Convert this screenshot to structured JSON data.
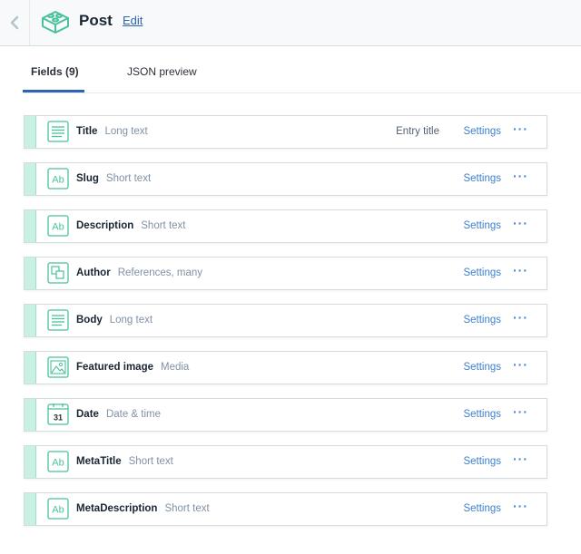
{
  "header": {
    "title": "Post",
    "edit_label": "Edit"
  },
  "tabs": [
    {
      "label": "Fields (9)",
      "active": true
    },
    {
      "label": "JSON preview",
      "active": false
    }
  ],
  "colors": {
    "accent": "#2d64b3",
    "link": "#3c80cf",
    "field_icon": "#49c29b",
    "handle": "#c9f1e1"
  },
  "fields": [
    {
      "name": "Title",
      "type": "Long text",
      "icon": "long-text-icon",
      "badge": "Entry title",
      "settings_label": "Settings",
      "more": "···"
    },
    {
      "name": "Slug",
      "type": "Short text",
      "icon": "short-text-icon",
      "settings_label": "Settings",
      "more": "···"
    },
    {
      "name": "Description",
      "type": "Short text",
      "icon": "short-text-icon",
      "settings_label": "Settings",
      "more": "···"
    },
    {
      "name": "Author",
      "type": "References, many",
      "icon": "references-icon",
      "settings_label": "Settings",
      "more": "···"
    },
    {
      "name": "Body",
      "type": "Long text",
      "icon": "long-text-icon",
      "settings_label": "Settings",
      "more": "···"
    },
    {
      "name": "Featured image",
      "type": "Media",
      "icon": "media-icon",
      "settings_label": "Settings",
      "more": "···"
    },
    {
      "name": "Date",
      "type": "Date & time",
      "icon": "date-icon",
      "icon_text": "31",
      "settings_label": "Settings",
      "more": "···"
    },
    {
      "name": "MetaTitle",
      "type": "Short text",
      "icon": "short-text-icon",
      "settings_label": "Settings",
      "more": "···"
    },
    {
      "name": "MetaDescription",
      "type": "Short text",
      "icon": "short-text-icon",
      "settings_label": "Settings",
      "more": "···"
    }
  ],
  "short_text_icon_label": "Ab"
}
